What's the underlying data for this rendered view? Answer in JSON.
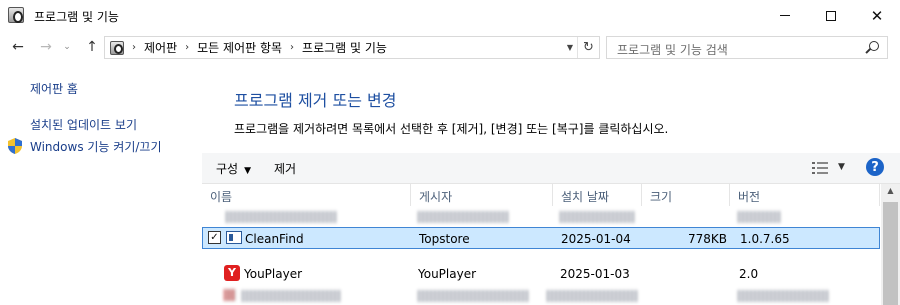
{
  "window": {
    "title": "프로그램 및 기능",
    "controls": {
      "minimize": "minimize",
      "maximize": "maximize",
      "close": "✕"
    }
  },
  "nav": {
    "back": "←",
    "forward": "→",
    "recent": "⌄",
    "up": "↑",
    "breadcrumbs": [
      "제어판",
      "모든 제어판 항목",
      "프로그램 및 기능"
    ],
    "separator": "›",
    "refresh": "↻",
    "search_placeholder": "프로그램 및 기능 검색"
  },
  "sidebar": {
    "links": [
      "제어판 홈",
      "설치된 업데이트 보기",
      "Windows 기능 켜기/끄기"
    ]
  },
  "main": {
    "title": "프로그램 제거 또는 변경",
    "description": "프로그램을 제거하려면 목록에서 선택한 후 [제거], [변경] 또는 [복구]를 클릭하십시오."
  },
  "toolbar": {
    "organize": "구성",
    "uninstall": "제거",
    "help": "?"
  },
  "columns": [
    "이름",
    "게시자",
    "설치 날짜",
    "크기",
    "버전"
  ],
  "rows": [
    {
      "name": "CleanFind",
      "publisher": "Topstore",
      "date": "2025-01-04",
      "size": "778KB",
      "version": "1.0.7.65",
      "selected": true,
      "checked": "✓"
    },
    {
      "name": "YouPlayer",
      "publisher": "YouPlayer",
      "date": "2025-01-03",
      "size": "",
      "version": "2.0",
      "selected": false,
      "icon_letter": "Y"
    }
  ],
  "colors": {
    "link": "#1a3e8a",
    "heading": "#1e4fa1",
    "selection": "#cce8ff",
    "selection_border": "#3f85d4",
    "help": "#1c64c8"
  }
}
